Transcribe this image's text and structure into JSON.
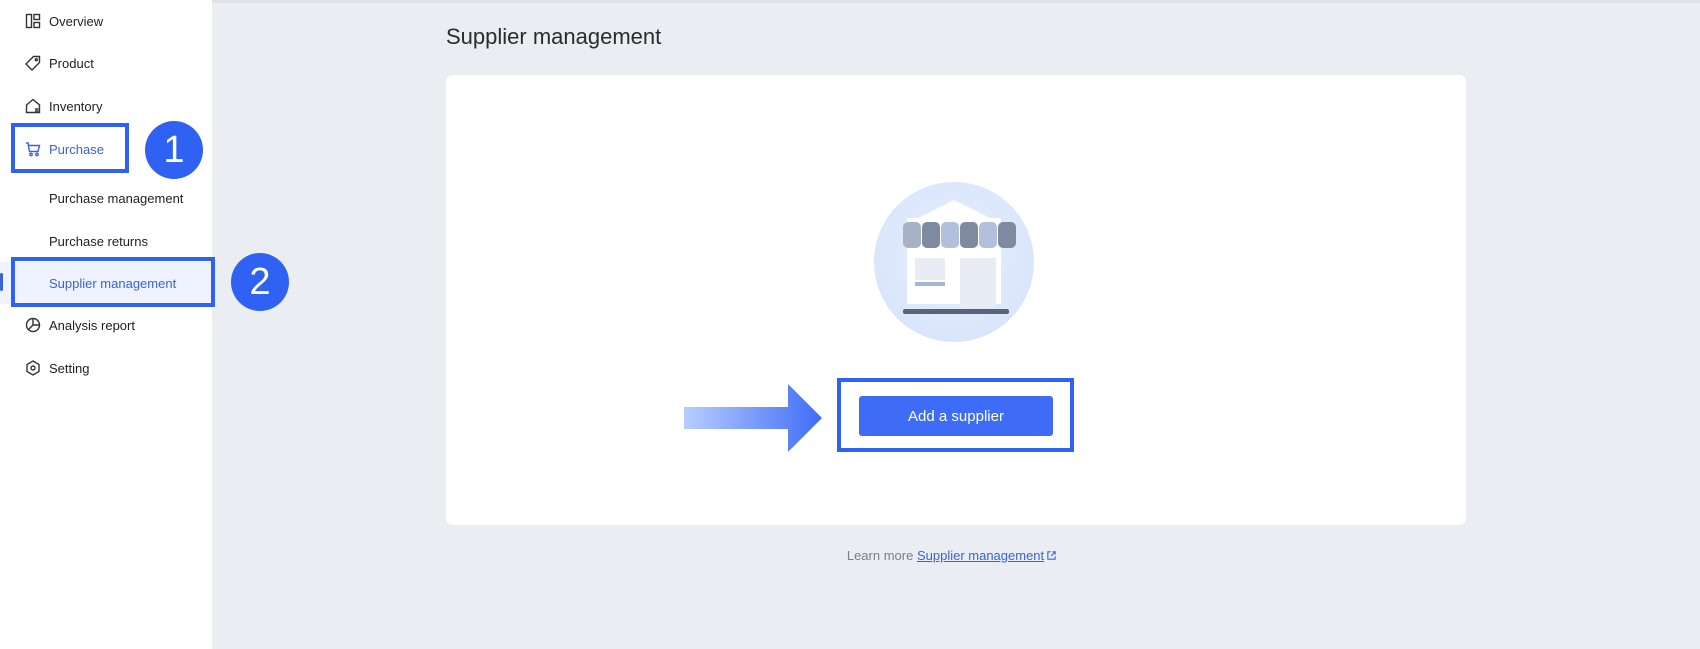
{
  "sidebar": {
    "items": [
      {
        "label": "Overview",
        "icon": "layout-icon"
      },
      {
        "label": "Product",
        "icon": "tag-icon"
      },
      {
        "label": "Inventory",
        "icon": "home-icon"
      },
      {
        "label": "Purchase",
        "icon": "cart-icon"
      },
      {
        "label": "Analysis report",
        "icon": "pie-chart-icon"
      },
      {
        "label": "Setting",
        "icon": "settings-icon"
      }
    ],
    "purchase_sub": [
      {
        "label": "Purchase management"
      },
      {
        "label": "Purchase returns"
      },
      {
        "label": "Supplier management"
      }
    ]
  },
  "annotations": {
    "step1": "1",
    "step2": "2"
  },
  "main": {
    "title": "Supplier management",
    "add_button": "Add a supplier",
    "learn_more_prefix": "Learn more",
    "learn_more_link": "Supplier management"
  },
  "colors": {
    "accent": "#3f6cf7",
    "highlight": "#2f62f3",
    "active_text": "#3a63d6",
    "background": "#eaedf2"
  }
}
